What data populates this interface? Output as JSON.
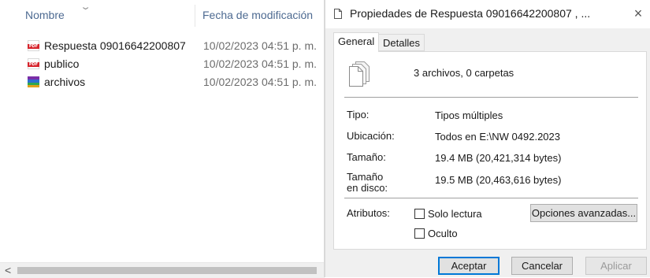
{
  "explorer": {
    "columns": {
      "name": "Nombre",
      "date": "Fecha de modificación"
    },
    "files": [
      {
        "name": "Respuesta 09016642200807",
        "date": "10/02/2023 04:51 p. m.",
        "icon": "pdf-file-icon"
      },
      {
        "name": "publico",
        "date": "10/02/2023 04:51 p. m.",
        "icon": "pdf-file-icon"
      },
      {
        "name": "archivos",
        "date": "10/02/2023 04:51 p. m.",
        "icon": "rar-archive-icon"
      }
    ],
    "pdf_badge": "PDF",
    "scroll_left_glyph": "<"
  },
  "dialog": {
    "title": "Propiedades de Respuesta 09016642200807 , ...",
    "close_glyph": "×",
    "tabs": [
      "General",
      "Detalles"
    ],
    "active_tab": "General",
    "summary": "3 archivos, 0 carpetas",
    "properties": [
      {
        "label": "Tipo:",
        "value": "Tipos múltiples"
      },
      {
        "label": "Ubicación:",
        "value": "Todos en E:\\NW 0492.2023"
      },
      {
        "label": "Tamaño:",
        "value": "19.4 MB (20,421,314 bytes)"
      },
      {
        "label": "Tamaño en disco:",
        "value": "19.5 MB (20,463,616 bytes)"
      }
    ],
    "attributes": {
      "label": "Atributos:",
      "read_only": {
        "label": "Solo lectura",
        "checked": false
      },
      "hidden": {
        "label": "Oculto",
        "checked": false
      },
      "advanced_button": "Opciones avanzadas..."
    },
    "buttons": {
      "ok": "Aceptar",
      "cancel": "Cancelar",
      "apply": "Aplicar"
    }
  },
  "colors": {
    "accent": "#0078d7",
    "header_text": "#4d6a91",
    "pdf_red": "#d6242c",
    "dialog_bg": "#f0f0f0"
  }
}
